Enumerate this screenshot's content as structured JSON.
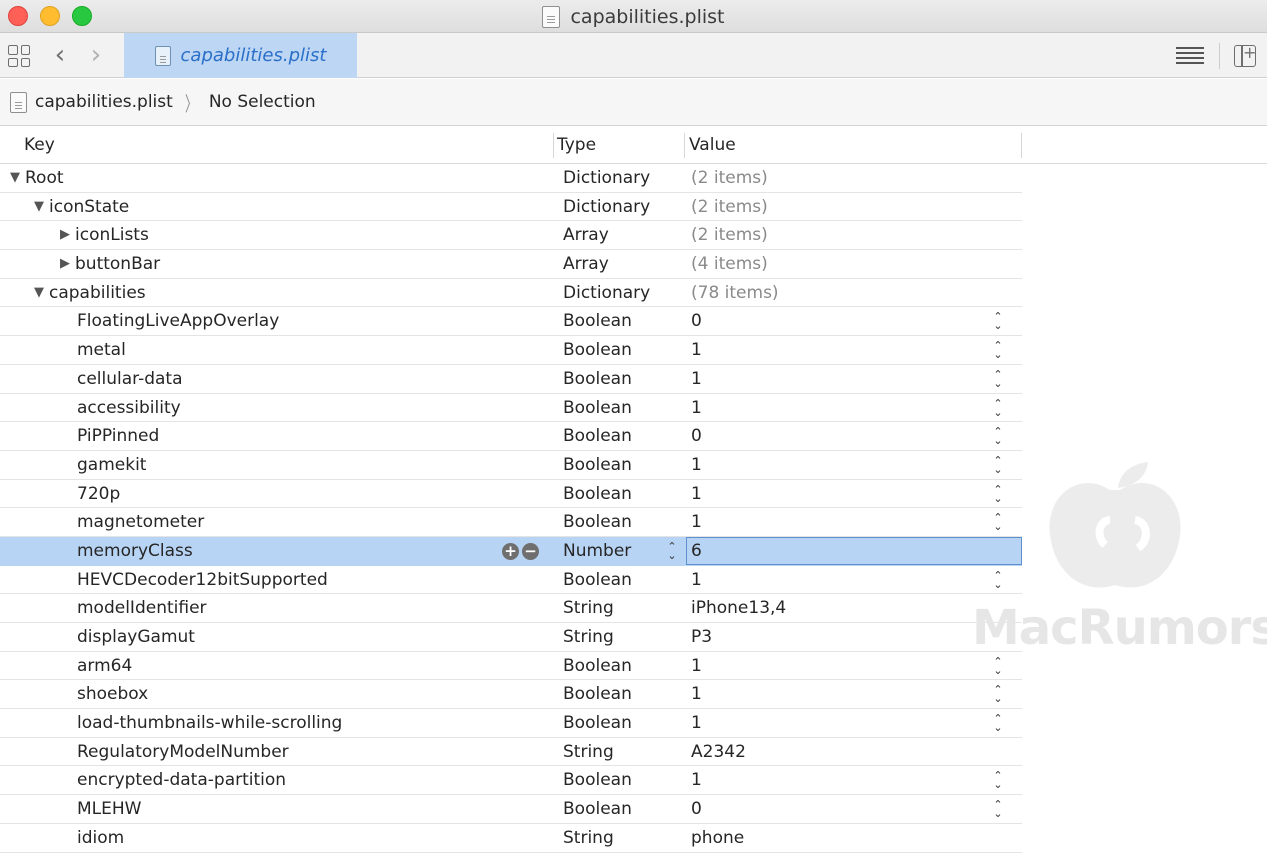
{
  "window": {
    "title": "capabilities.plist"
  },
  "toolbar": {
    "tab_label": "capabilities.plist"
  },
  "breadcrumb": {
    "file": "capabilities.plist",
    "selection": "No Selection"
  },
  "table": {
    "headers": {
      "key": "Key",
      "type": "Type",
      "value": "Value"
    },
    "rows": [
      {
        "key": "Root",
        "type": "Dictionary",
        "value": "(2 items)",
        "level": 0,
        "disclosure": "open",
        "summary": true
      },
      {
        "key": "iconState",
        "type": "Dictionary",
        "value": "(2 items)",
        "level": 1,
        "disclosure": "open",
        "summary": true
      },
      {
        "key": "iconLists",
        "type": "Array",
        "value": "(2 items)",
        "level": 2,
        "disclosure": "closed",
        "summary": true
      },
      {
        "key": "buttonBar",
        "type": "Array",
        "value": "(4 items)",
        "level": 2,
        "disclosure": "closed",
        "summary": true
      },
      {
        "key": "capabilities",
        "type": "Dictionary",
        "value": "(78 items)",
        "level": 1,
        "disclosure": "open",
        "summary": true
      },
      {
        "key": "FloatingLiveAppOverlay",
        "type": "Boolean",
        "value": "0",
        "level": 2,
        "stepper": true
      },
      {
        "key": "metal",
        "type": "Boolean",
        "value": "1",
        "level": 2,
        "stepper": true
      },
      {
        "key": "cellular-data",
        "type": "Boolean",
        "value": "1",
        "level": 2,
        "stepper": true
      },
      {
        "key": "accessibility",
        "type": "Boolean",
        "value": "1",
        "level": 2,
        "stepper": true
      },
      {
        "key": "PiPPinned",
        "type": "Boolean",
        "value": "0",
        "level": 2,
        "stepper": true
      },
      {
        "key": "gamekit",
        "type": "Boolean",
        "value": "1",
        "level": 2,
        "stepper": true
      },
      {
        "key": "720p",
        "type": "Boolean",
        "value": "1",
        "level": 2,
        "stepper": true
      },
      {
        "key": "magnetometer",
        "type": "Boolean",
        "value": "1",
        "level": 2,
        "stepper": true
      },
      {
        "key": "memoryClass",
        "type": "Number",
        "value": "6",
        "level": 2,
        "selected": true
      },
      {
        "key": "HEVCDecoder12bitSupported",
        "type": "Boolean",
        "value": "1",
        "level": 2,
        "stepper": true
      },
      {
        "key": "modelIdentifier",
        "type": "String",
        "value": "iPhone13,4",
        "level": 2
      },
      {
        "key": "displayGamut",
        "type": "String",
        "value": "P3",
        "level": 2
      },
      {
        "key": "arm64",
        "type": "Boolean",
        "value": "1",
        "level": 2,
        "stepper": true
      },
      {
        "key": "shoebox",
        "type": "Boolean",
        "value": "1",
        "level": 2,
        "stepper": true
      },
      {
        "key": "load-thumbnails-while-scrolling",
        "type": "Boolean",
        "value": "1",
        "level": 2,
        "stepper": true
      },
      {
        "key": "RegulatoryModelNumber",
        "type": "String",
        "value": "A2342",
        "level": 2
      },
      {
        "key": "encrypted-data-partition",
        "type": "Boolean",
        "value": "1",
        "level": 2,
        "stepper": true
      },
      {
        "key": "MLEHW",
        "type": "Boolean",
        "value": "0",
        "level": 2,
        "stepper": true
      },
      {
        "key": "idiom",
        "type": "String",
        "value": "phone",
        "level": 2
      }
    ]
  },
  "watermark": {
    "text": "MacRumors"
  },
  "colors": {
    "selection": "#b8d4f4",
    "tab": "#bcd6f3",
    "accent": "#2a6fc9"
  },
  "icons": [
    "grid-icon",
    "back-icon",
    "forward-icon",
    "document-icon",
    "lines-icon",
    "add-panel-icon",
    "disclosure-triangle-icon",
    "stepper-icon",
    "add-icon",
    "remove-icon"
  ]
}
